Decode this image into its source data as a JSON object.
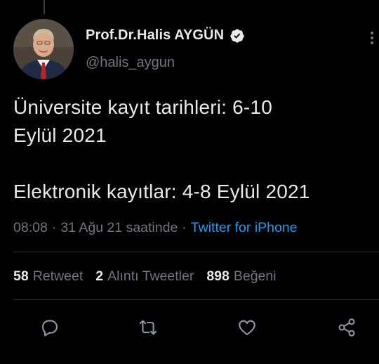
{
  "author": {
    "display_name": "Prof.Dr.Halis AYGÜN",
    "handle": "@halis_aygun",
    "verified": true
  },
  "tweet": {
    "text": "Üniversite kayıt tarihleri: 6-10\nEylül 2021\n\nElektronik kayıtlar: 4-8 Eylül 2021"
  },
  "meta": {
    "time": "08:08",
    "separator": "·",
    "date": "31 Ağu 21 saatinde",
    "source": "Twitter for iPhone"
  },
  "stats": {
    "retweets_count": "58",
    "retweets_label": "Retweet",
    "quotes_count": "2",
    "quotes_label": "Alıntı Tweetler",
    "likes_count": "898",
    "likes_label": "Beğeni"
  },
  "actions": [
    {
      "icon": "reply-icon"
    },
    {
      "icon": "retweet-icon"
    },
    {
      "icon": "like-icon"
    },
    {
      "icon": "share-icon"
    }
  ],
  "colors": {
    "background": "#000000",
    "text": "#e7e9ea",
    "muted": "#71767b",
    "link": "#1d9bf0",
    "divider": "#2f3336",
    "verified_badge": "#e7e9ea"
  }
}
